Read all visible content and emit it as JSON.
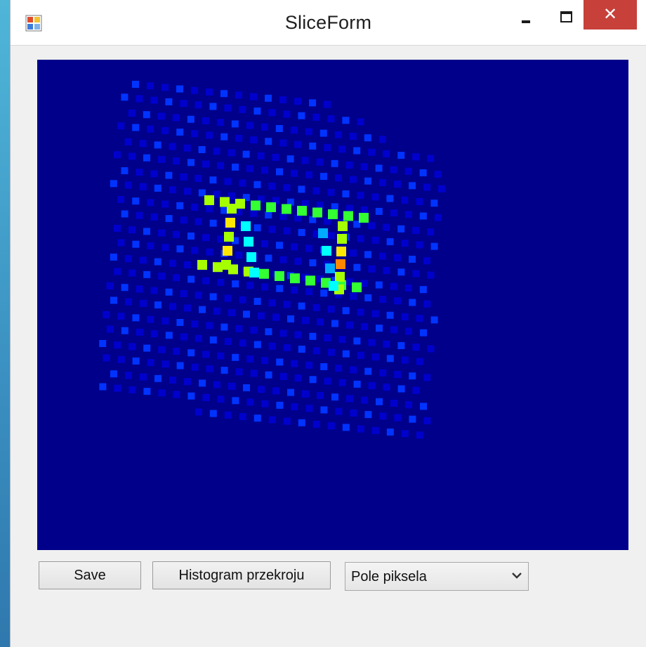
{
  "window": {
    "title": "SliceForm"
  },
  "controls": {
    "close_glyph": "✕"
  },
  "buttons": {
    "save": "Save",
    "histogram": "Histogram przekroju"
  },
  "dropdown": {
    "selected": "Pole piksela"
  },
  "colors": {
    "canvas_background": "#00008b",
    "colormap": [
      "#0000cd",
      "#0033ff",
      "#00aaff",
      "#00ffff",
      "#33ff33",
      "#a6ff00",
      "#ffe600",
      "#ff8800",
      "#ff3300"
    ],
    "close_button": "#c7403a"
  }
}
